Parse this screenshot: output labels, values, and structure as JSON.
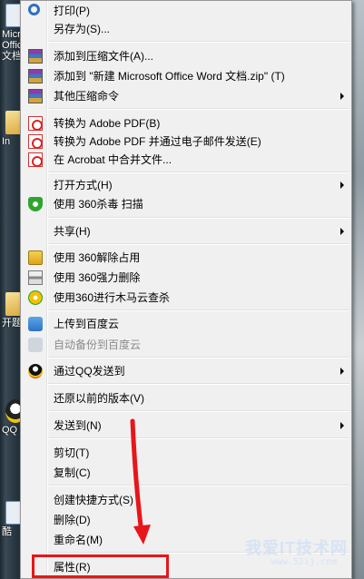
{
  "desktop": {
    "items": [
      {
        "label": "Micr Offic 文档"
      },
      {
        "label": "In"
      },
      {
        "label": "开题"
      },
      {
        "label": "QQ"
      },
      {
        "label": "酷"
      }
    ]
  },
  "menu": {
    "items": [
      {
        "label": "打印(P)",
        "icon": "magnifier-icon"
      },
      {
        "label": "另存为(S)...",
        "icon": ""
      },
      {
        "label": "添加到压缩文件(A)...",
        "icon": "winrar-icon"
      },
      {
        "label": "添加到 \"新建 Microsoft Office Word 文档.zip\" (T)",
        "icon": "winrar-icon"
      },
      {
        "label": "其他压缩命令",
        "icon": "winrar-icon",
        "submenu": true
      },
      {
        "label": "转换为 Adobe PDF(B)",
        "icon": "pdf-icon"
      },
      {
        "label": "转换为 Adobe PDF 并通过电子邮件发送(E)",
        "icon": "pdf-icon"
      },
      {
        "label": "在 Acrobat 中合并文件...",
        "icon": "pdf-icon"
      },
      {
        "label": "打开方式(H)",
        "icon": "",
        "submenu": true
      },
      {
        "label": "使用 360杀毒 扫描",
        "icon": "360-shield-icon"
      },
      {
        "label": "共享(H)",
        "icon": "",
        "submenu": true
      },
      {
        "label": "使用 360解除占用",
        "icon": "unlock-icon"
      },
      {
        "label": "使用 360强力删除",
        "icon": "shredder-icon"
      },
      {
        "label": "使用360进行木马云查杀",
        "icon": "trojan-scan-icon"
      },
      {
        "label": "上传到百度云",
        "icon": "baidu-cloud-icon"
      },
      {
        "label": "自动备份到百度云",
        "icon": "baidu-cloud-disabled-icon",
        "disabled": true
      },
      {
        "label": "通过QQ发送到",
        "icon": "qq-icon",
        "submenu": true
      },
      {
        "label": "还原以前的版本(V)",
        "icon": ""
      },
      {
        "label": "发送到(N)",
        "icon": "",
        "submenu": true
      },
      {
        "label": "剪切(T)",
        "icon": ""
      },
      {
        "label": "复制(C)",
        "icon": ""
      },
      {
        "label": "创建快捷方式(S)",
        "icon": ""
      },
      {
        "label": "删除(D)",
        "icon": ""
      },
      {
        "label": "重命名(M)",
        "icon": ""
      },
      {
        "label": "属性(R)",
        "icon": ""
      }
    ]
  },
  "watermark": {
    "title": "我爱IT技术网",
    "url": "www.52ij.com"
  },
  "colors": {
    "highlight": "#e8151a",
    "menu_bg": "#f0f0f0"
  }
}
